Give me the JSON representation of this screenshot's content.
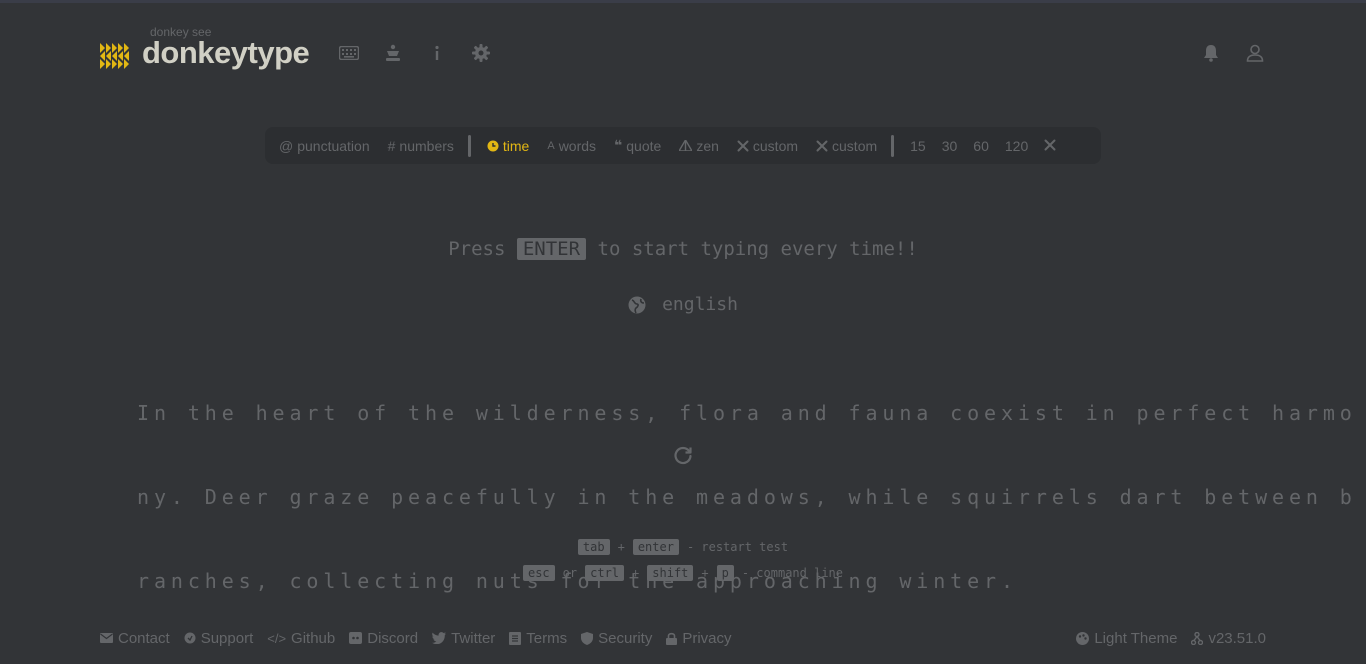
{
  "header": {
    "logo_sub": "donkey see",
    "logo_title": "donkeytype",
    "nav": [
      "keyboard-icon",
      "crown-icon",
      "info-icon",
      "settings-icon"
    ],
    "right": [
      "notifications-icon",
      "account-icon"
    ]
  },
  "config": {
    "punctuation": "punctuation",
    "numbers": "numbers",
    "modes": [
      "time",
      "words",
      "quote",
      "zen",
      "custom",
      "custom"
    ],
    "active_mode": "time",
    "durations": [
      "15",
      "30",
      "60",
      "120"
    ],
    "accent_color": "#e2b714"
  },
  "test": {
    "press_prefix": "Press",
    "press_key": "ENTER",
    "press_suffix": "to start typing every time!!",
    "language": "english",
    "lines": [
      "In the heart of the wilderness, flora and fauna coexist in perfect harmo",
      "ny. Deer graze peacefully in the meadows, while squirrels dart between b",
      "ranches, collecting nuts for the approaching winter."
    ]
  },
  "hints": {
    "line1": {
      "k1": "tab",
      "plus": "+",
      "k2": "enter",
      "text": "- restart test"
    },
    "line2": {
      "k1": "esc",
      "or": "or",
      "k2": "ctrl",
      "plus1": "+",
      "k3": "shift",
      "plus2": "+",
      "k4": "p",
      "text": "- command line"
    }
  },
  "footer": {
    "links": [
      "Contact",
      "Support",
      "Github",
      "Discord",
      "Twitter",
      "Terms",
      "Security",
      "Privacy"
    ],
    "theme": "Light Theme",
    "version": "v23.51.0"
  }
}
